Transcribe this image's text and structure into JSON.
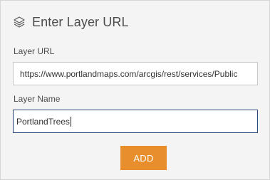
{
  "dialog": {
    "title": "Enter Layer URL",
    "title_icon": "layers-icon"
  },
  "fields": {
    "url_label": "Layer URL",
    "url_value": "https://www.portlandmaps.com/arcgis/rest/services/Public",
    "name_label": "Layer Name",
    "name_value": "PortlandTrees"
  },
  "actions": {
    "add_label": "ADD"
  },
  "colors": {
    "panel_bg": "#f4f4f4",
    "accent_button": "#e88e2c",
    "focus_border": "#2a4a7a",
    "text": "#4c4c4c"
  }
}
